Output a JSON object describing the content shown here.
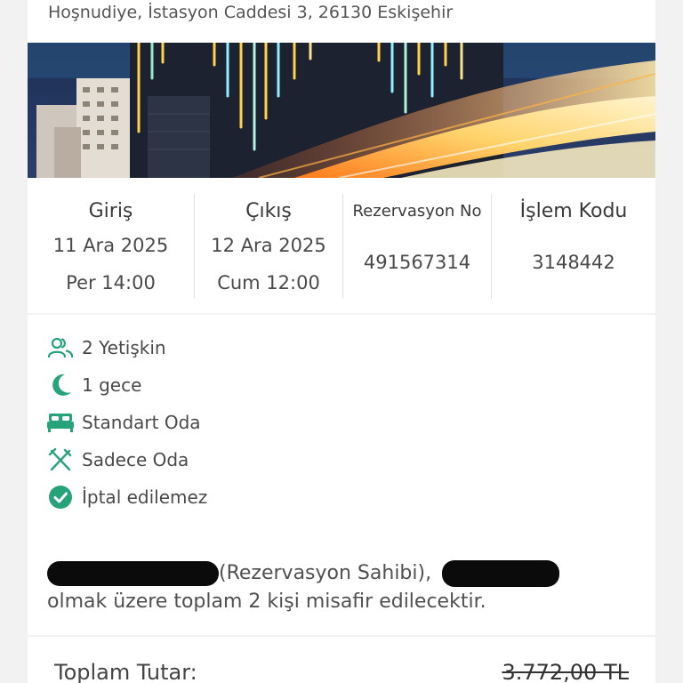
{
  "hotel": {
    "address": "Hoşnudiye, İstasyon Caddesi 3, 26130 Eskişehir"
  },
  "stay": {
    "checkin_label": "Giriş",
    "checkin_date": "11 Ara 2025",
    "checkin_time": "Per 14:00",
    "checkout_label": "Çıkış",
    "checkout_date": "12 Ara 2025",
    "checkout_time": "Cum 12:00",
    "reservation_label": "Rezervasyon No",
    "reservation_no": "491567314",
    "transaction_label": "İşlem Kodu",
    "transaction_code": "3148442"
  },
  "features": [
    {
      "icon": "guests-icon",
      "label": "2 Yetişkin"
    },
    {
      "icon": "moon-icon",
      "label": "1 gece"
    },
    {
      "icon": "bed-icon",
      "label": "Standart Oda"
    },
    {
      "icon": "utensils-crossed-icon",
      "label": "Sadece Oda"
    },
    {
      "icon": "check-circle-icon",
      "label": "İptal edilemez"
    }
  ],
  "guests_note": {
    "owner_suffix": "(Rezervasyon Sahibi),",
    "line2": "olmak üzere toplam 2 kişi misafir edilecektir."
  },
  "price": {
    "total_label": "Toplam Tutar:",
    "original_total": "3.772,00 TL"
  },
  "colors": {
    "accent": "#27a37a",
    "background": "#f2f2f2",
    "card": "#ffffff"
  }
}
